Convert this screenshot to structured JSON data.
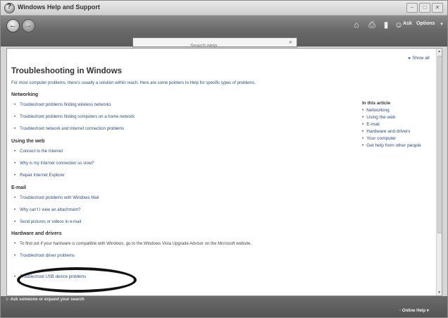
{
  "window": {
    "title": "Windows Help and Support"
  },
  "toolbar": {
    "ask_label": "Ask",
    "options_label": "Options",
    "search_placeholder": "Search Help"
  },
  "content": {
    "show_all": "Show all",
    "title": "Troubleshooting in Windows",
    "intro": "For most computer problems, there's usually a solution within reach. Here are some pointers to Help for specific types of problems.",
    "sections": [
      {
        "heading": "Networking",
        "items": [
          "Troubleshoot problems finding wireless networks",
          "Troubleshoot problems finding computers on a home network",
          "Troubleshoot network and Internet connection problems"
        ]
      },
      {
        "heading": "Using the web",
        "items": [
          "Connect to the Internet",
          "Why is my Internet connection so slow?",
          "Repair Internet Explorer"
        ]
      },
      {
        "heading": "E-mail",
        "items": [
          "Troubleshoot problems with Windows Mail",
          "Why can't I view an attachment?",
          "Send pictures or videos in e-mail"
        ]
      },
      {
        "heading": "Hardware and drivers",
        "items": [
          "To find out if your hardware is compatible with Windows, go to the Windows Vista Upgrade Advisor on the Microsoft website.",
          "Troubleshoot driver problems",
          "Troubleshoot USB device problems"
        ]
      }
    ],
    "in_this_article": {
      "title": "In this article",
      "items": [
        "Networking",
        "Using the web",
        "E-mail",
        "Hardware and drivers",
        "Your computer",
        "Get help from other people"
      ]
    }
  },
  "bottom": {
    "ask_expand": "Ask someone or expand your search",
    "online_help": "Online Help"
  }
}
